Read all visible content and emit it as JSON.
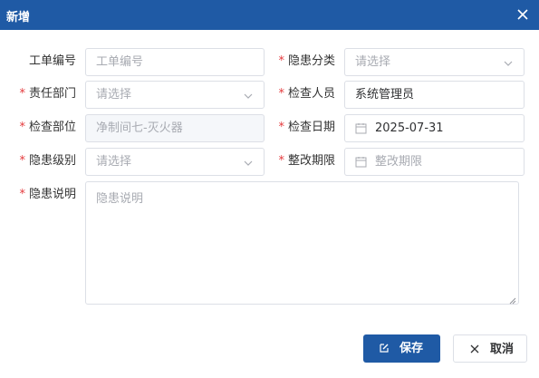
{
  "dialog": {
    "title": "新增",
    "close_icon": "close-icon"
  },
  "form": {
    "required_mark": "*",
    "work_order_no": {
      "label": "工单编号",
      "placeholder": "工单编号",
      "value": ""
    },
    "hazard_category": {
      "label": "隐患分类",
      "placeholder": "请选择",
      "value": ""
    },
    "responsible_dept": {
      "label": "责任部门",
      "placeholder": "请选择",
      "value": ""
    },
    "inspector": {
      "label": "检查人员",
      "value": "系统管理员"
    },
    "inspection_location": {
      "label": "检查部位",
      "value": "净制间七-灭火器"
    },
    "inspection_date": {
      "label": "检查日期",
      "value": "2025-07-31"
    },
    "hazard_level": {
      "label": "隐患级别",
      "placeholder": "请选择",
      "value": ""
    },
    "rectify_deadline": {
      "label": "整改期限",
      "placeholder": "整改期限",
      "value": ""
    },
    "hazard_description": {
      "label": "隐患说明",
      "placeholder": "隐患说明",
      "value": ""
    }
  },
  "footer": {
    "save_label": "保存",
    "cancel_label": "取消"
  },
  "colors": {
    "primary": "#1f5aa5",
    "required": "#e4393c",
    "border": "#dcdfe6",
    "placeholder": "#a8abb2"
  }
}
